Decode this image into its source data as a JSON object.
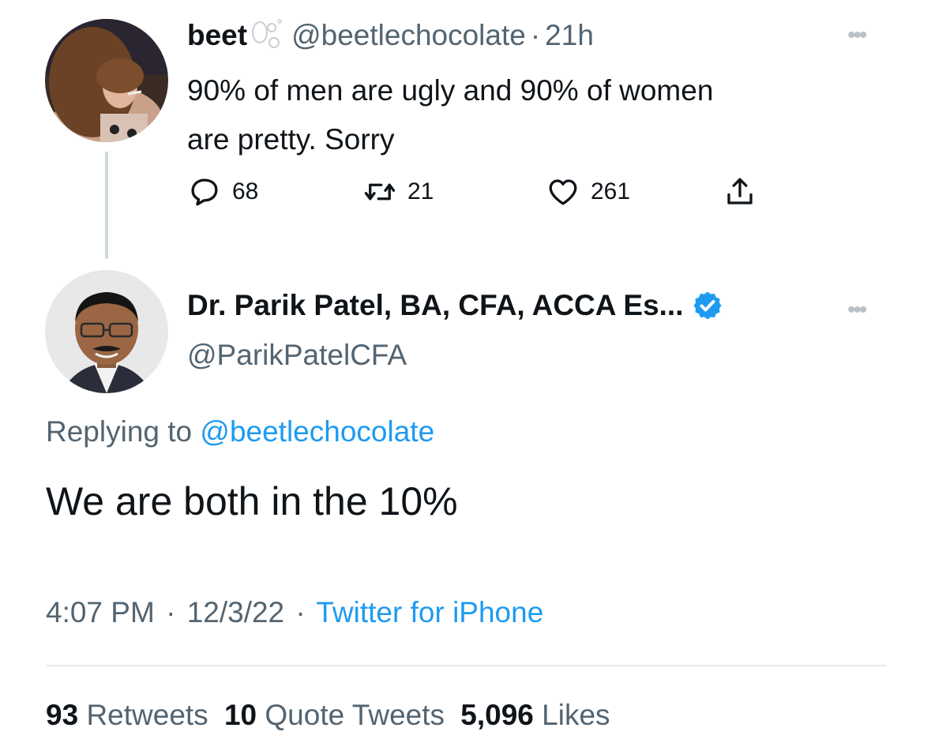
{
  "original_tweet": {
    "display_name": "beet",
    "handle": "@beetlechocolate",
    "separator": "·",
    "time": "21h",
    "text_line1": "90% of men are ugly and 90% of women",
    "text_line2": "are pretty. Sorry",
    "replies": "68",
    "retweets": "21",
    "likes": "261"
  },
  "reply_tweet": {
    "display_name": "Dr. Parik Patel, BA, CFA, ACCA Es...",
    "handle": "@ParikPatelCFA",
    "verified": true,
    "replying_prefix": "Replying to",
    "replying_handle": "@beetlechocolate",
    "text": "We are both in the 10%",
    "time": "4:07 PM",
    "date": "12/3/22",
    "dot": "·",
    "source": "Twitter for iPhone"
  },
  "stats": {
    "retweets_count": "93",
    "retweets_label": "Retweets",
    "quotes_count": "10",
    "quotes_label": "Quote Tweets",
    "likes_count": "5,096",
    "likes_label": "Likes"
  },
  "colors": {
    "accent": "#1d9bf0",
    "text": "#0f1419",
    "secondary": "#536471",
    "line": "#cfd9de",
    "more_dots": "#b9c1c7"
  }
}
